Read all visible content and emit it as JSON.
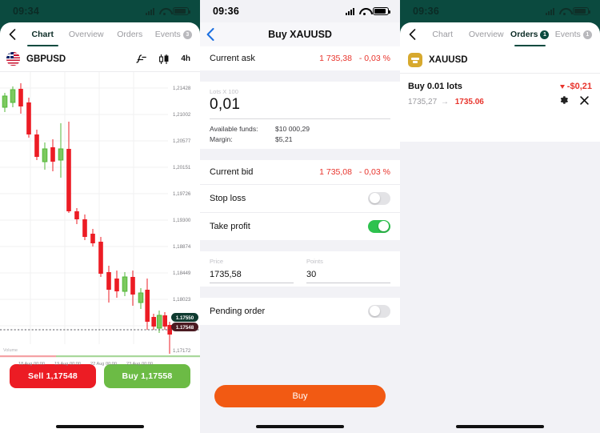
{
  "panel1": {
    "status": {
      "time": "09:34"
    },
    "tabs": [
      {
        "label": "Chart",
        "badge": "",
        "active": true
      },
      {
        "label": "Overview",
        "badge": "",
        "active": false
      },
      {
        "label": "Orders",
        "badge": "",
        "active": false
      },
      {
        "label": "Events",
        "badge": "3",
        "active": false
      }
    ],
    "symbol": "GBPUSD",
    "tools": {
      "indicator": "f",
      "candles": "candlestick-type",
      "timeframe": "4h"
    },
    "sell_button": "Sell 1,17548",
    "buy_button": "Buy 1,17558",
    "chart_data": {
      "type": "candlestick",
      "title": "GBPUSD 4h",
      "ylabel": "",
      "xlabel": "",
      "grid": true,
      "y_ticks": [
        "1,21428",
        "1,21002",
        "1,20577",
        "1,20151",
        "1,19726",
        "1,19300",
        "1,18874",
        "1,18449",
        "1,18023",
        "1,17172"
      ],
      "y_values": [
        1.21428,
        1.21002,
        1.20577,
        1.20151,
        1.19726,
        1.193,
        1.18874,
        1.18449,
        1.18023,
        1.17172
      ],
      "x_ticks": [
        "18 Aug 00:00",
        "19 Aug 00:00",
        "22 Aug 00:00",
        "23 Aug 00:00"
      ],
      "volume_label": "Volume",
      "current_ask_pill": "1.17550",
      "current_bid_pill": "1.17548",
      "ylim": [
        1.171,
        1.216
      ],
      "candles": [
        {
          "o": 1.2105,
          "h": 1.2118,
          "l": 1.2078,
          "c": 1.209,
          "dir": "up"
        },
        {
          "o": 1.209,
          "h": 1.2132,
          "l": 1.2085,
          "c": 1.2126,
          "dir": "up"
        },
        {
          "o": 1.213,
          "h": 1.215,
          "l": 1.2098,
          "c": 1.2102,
          "dir": "down"
        },
        {
          "o": 1.2102,
          "h": 1.211,
          "l": 1.2038,
          "c": 1.2045,
          "dir": "down"
        },
        {
          "o": 1.2045,
          "h": 1.2052,
          "l": 1.2008,
          "c": 1.2018,
          "dir": "down"
        },
        {
          "o": 1.2015,
          "h": 1.2056,
          "l": 1.2002,
          "c": 1.2028,
          "dir": "up"
        },
        {
          "o": 1.2029,
          "h": 1.2042,
          "l": 1.1995,
          "c": 1.2006,
          "dir": "down"
        },
        {
          "o": 1.2005,
          "h": 1.2062,
          "l": 1.1962,
          "c": 1.2018,
          "dir": "up"
        },
        {
          "o": 1.202,
          "h": 1.2068,
          "l": 1.1995,
          "c": 1.1922,
          "dir": "down"
        },
        {
          "o": 1.1923,
          "h": 1.193,
          "l": 1.19,
          "c": 1.1908,
          "dir": "down"
        },
        {
          "o": 1.1908,
          "h": 1.1913,
          "l": 1.1868,
          "c": 1.1874,
          "dir": "down"
        },
        {
          "o": 1.1876,
          "h": 1.1902,
          "l": 1.186,
          "c": 1.1864,
          "dir": "down"
        },
        {
          "o": 1.1864,
          "h": 1.1868,
          "l": 1.1818,
          "c": 1.1825,
          "dir": "down"
        },
        {
          "o": 1.1826,
          "h": 1.1838,
          "l": 1.1776,
          "c": 1.1798,
          "dir": "down"
        },
        {
          "o": 1.1798,
          "h": 1.1832,
          "l": 1.177,
          "c": 1.1808,
          "dir": "down"
        },
        {
          "o": 1.1802,
          "h": 1.1828,
          "l": 1.1782,
          "c": 1.1816,
          "dir": "up"
        },
        {
          "o": 1.1816,
          "h": 1.183,
          "l": 1.177,
          "c": 1.178,
          "dir": "down"
        },
        {
          "o": 1.178,
          "h": 1.1788,
          "l": 1.1752,
          "c": 1.1762,
          "dir": "up"
        },
        {
          "o": 1.1762,
          "h": 1.1818,
          "l": 1.1736,
          "c": 1.1752,
          "dir": "down"
        },
        {
          "o": 1.1752,
          "h": 1.1762,
          "l": 1.174,
          "c": 1.1746,
          "dir": "down"
        },
        {
          "o": 1.1746,
          "h": 1.1768,
          "l": 1.1738,
          "c": 1.1762,
          "dir": "up"
        },
        {
          "o": 1.1762,
          "h": 1.177,
          "l": 1.1745,
          "c": 1.175,
          "dir": "down"
        },
        {
          "o": 1.1756,
          "h": 1.176,
          "l": 1.1717,
          "c": 1.1748,
          "dir": "down"
        }
      ]
    }
  },
  "panel2": {
    "status": {
      "time": "09:36"
    },
    "title": "Buy XAUUSD",
    "current_ask": {
      "label": "Current ask",
      "price": "1 735,38",
      "change": "- 0,03 %"
    },
    "lots": {
      "label": "Lots X 100",
      "value": "0,01"
    },
    "available_funds": {
      "label": "Available funds:",
      "value": "$10 000,29"
    },
    "margin": {
      "label": "Margin:",
      "value": "$5,21"
    },
    "current_bid": {
      "label": "Current bid",
      "price": "1 735,08",
      "change": "- 0,03 %"
    },
    "stop_loss": {
      "label": "Stop loss",
      "on": false
    },
    "take_profit": {
      "label": "Take profit",
      "on": true
    },
    "price_field": {
      "label": "Price",
      "value": "1735,58"
    },
    "points_field": {
      "label": "Points",
      "value": "30"
    },
    "pending_order": {
      "label": "Pending order",
      "on": false
    },
    "submit_button": "Buy"
  },
  "panel3": {
    "status": {
      "time": "09:36"
    },
    "tabs": [
      {
        "label": "Chart",
        "badge": "",
        "active": false
      },
      {
        "label": "Overview",
        "badge": "",
        "active": false
      },
      {
        "label": "Orders",
        "badge": "1",
        "active": true
      },
      {
        "label": "Events",
        "badge": "1",
        "active": false
      }
    ],
    "symbol": "XAUUSD",
    "order": {
      "title": "Buy 0.01 lots",
      "pnl": "-$0,21",
      "open_price": "1735,27",
      "current_price": "1735.06",
      "arrow": "→"
    }
  },
  "colors": {
    "brand_green": "#0b4a3f",
    "up": "#53b83a",
    "down": "#ec1c24",
    "orange": "#f25a13",
    "toggle_on": "#2ec24e",
    "gold": "#d7a92e"
  }
}
